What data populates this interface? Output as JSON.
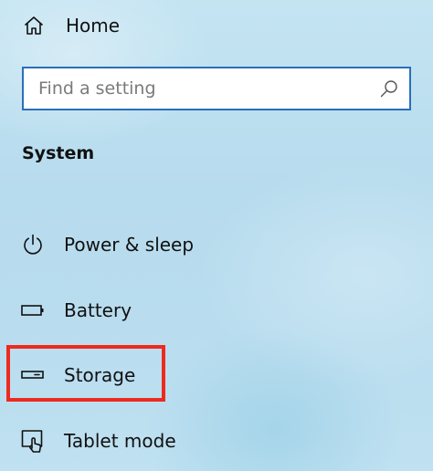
{
  "home": {
    "label": "Home",
    "icon": "home-icon"
  },
  "search": {
    "value": "",
    "placeholder": "Find a setting",
    "icon": "search-icon"
  },
  "section": {
    "title": "System"
  },
  "nav_items": [
    {
      "label": "Power & sleep",
      "icon": "power-icon"
    },
    {
      "label": "Battery",
      "icon": "battery-icon"
    },
    {
      "label": "Storage",
      "icon": "storage-icon"
    },
    {
      "label": "Tablet mode",
      "icon": "tablet-mode-icon"
    }
  ],
  "colors": {
    "search_border": "#2a6fb9",
    "highlight": "#ee2a1f",
    "text": "#111111",
    "placeholder": "#7a7a7a"
  }
}
